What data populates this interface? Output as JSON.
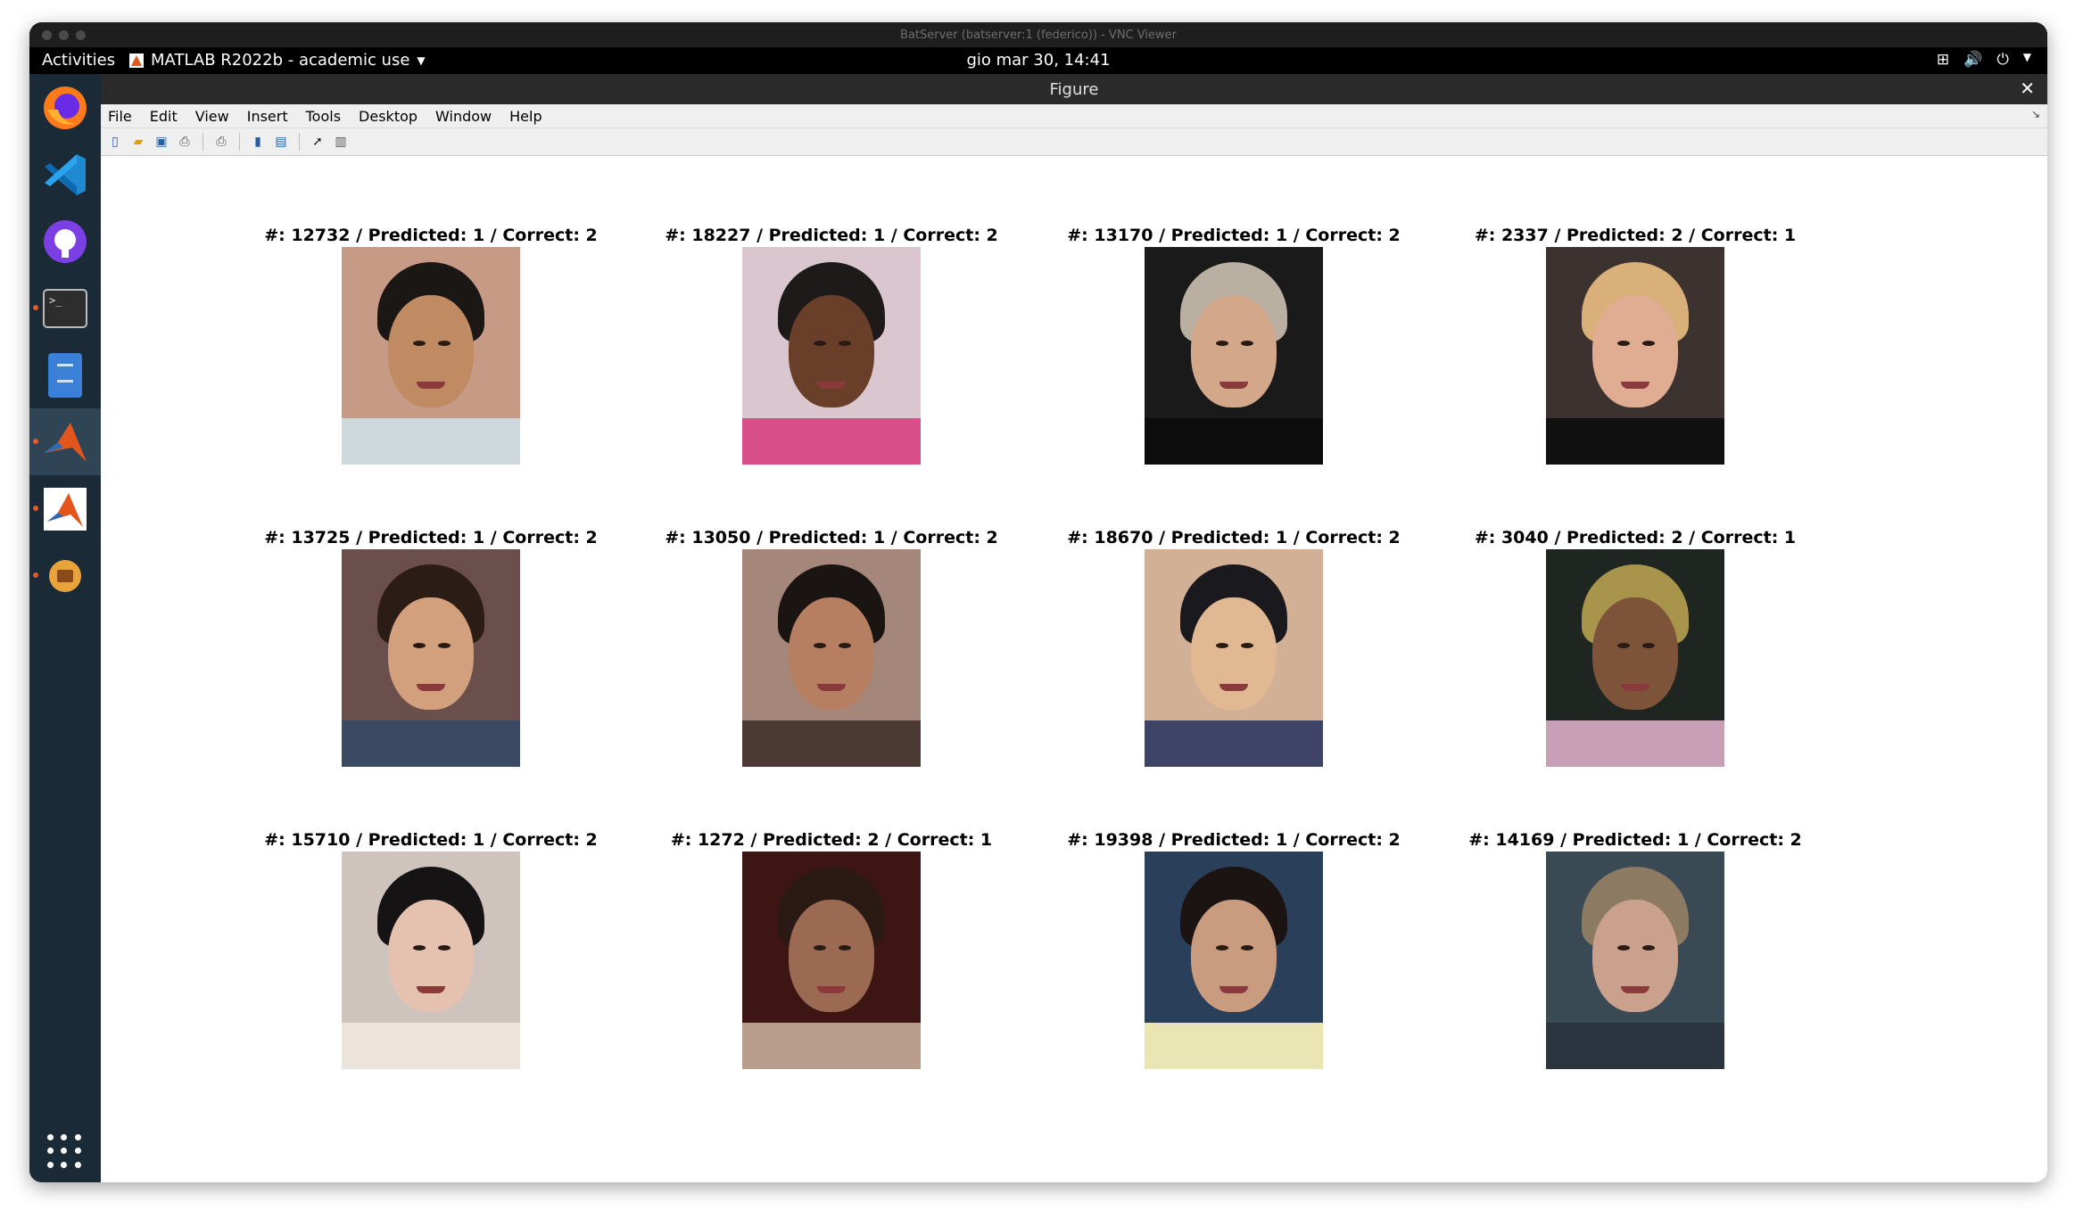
{
  "vnc": {
    "title": "BatServer (batserver:1 (federico)) - VNC Viewer"
  },
  "topbar": {
    "activities": "Activities",
    "app_name": "MATLAB R2022b - academic use",
    "clock": "gio mar 30, 14:41"
  },
  "dock": {
    "items": [
      "firefox-icon",
      "vscode-icon",
      "github-icon",
      "terminal-icon",
      "files-icon",
      "matlab-icon",
      "matlab-alt-icon",
      "software-icon"
    ]
  },
  "figure": {
    "title": "Figure",
    "menu": [
      "File",
      "Edit",
      "View",
      "Insert",
      "Tools",
      "Desktop",
      "Window",
      "Help"
    ],
    "toolbar": [
      "new-file-icon",
      "open-icon",
      "save-icon",
      "print-icon",
      "print-figure-icon",
      "link-icon",
      "insert-legend-icon",
      "pointer-icon",
      "property-editor-icon"
    ]
  },
  "grid": {
    "images": [
      {
        "title": "#: 12732 / Predicted: 1 / Correct: 2",
        "bg": "#c79a86",
        "skin": "#c08a62",
        "hair": "#1b1715",
        "shirt": "#cfd8dc"
      },
      {
        "title": "#: 18227 / Predicted: 1 / Correct: 2",
        "bg": "#d9c6cf",
        "skin": "#6a3f2a",
        "hair": "#1e1a1a",
        "shirt": "#d94f87"
      },
      {
        "title": "#: 13170 / Predicted: 1 / Correct: 2",
        "bg": "#1a1a1a",
        "skin": "#d2a78a",
        "hair": "#b9b0a2",
        "shirt": "#0c0c0c"
      },
      {
        "title": "#: 2337 / Predicted: 2 / Correct: 1",
        "bg": "#3c3330",
        "skin": "#e0ad92",
        "hair": "#d9b07a",
        "shirt": "#111111"
      },
      {
        "title": "#: 13725 / Predicted: 1 / Correct: 2",
        "bg": "#6a4f4c",
        "skin": "#d2a07d",
        "hair": "#2b1d16",
        "shirt": "#3a4a63"
      },
      {
        "title": "#: 13050 / Predicted: 1 / Correct: 2",
        "bg": "#a5867a",
        "skin": "#b67f61",
        "hair": "#1a1513",
        "shirt": "#4b3a33"
      },
      {
        "title": "#: 18670 / Predicted: 1 / Correct: 2",
        "bg": "#d2b095",
        "skin": "#e0b892",
        "hair": "#1a1a1e",
        "shirt": "#3f4466"
      },
      {
        "title": "#: 3040 / Predicted: 2 / Correct: 1",
        "bg": "#1f2520",
        "skin": "#7d533a",
        "hair": "#a8944a",
        "shirt": "#c7a0b6"
      },
      {
        "title": "#: 15710 / Predicted: 1 / Correct: 2",
        "bg": "#cfc4bd",
        "skin": "#e5c1b0",
        "hair": "#151313",
        "shirt": "#ece4dc"
      },
      {
        "title": "#: 1272 / Predicted: 2 / Correct: 1",
        "bg": "#3d1512",
        "skin": "#9c6a52",
        "hair": "#2b1a14",
        "shirt": "#b89c8c"
      },
      {
        "title": "#: 19398 / Predicted: 1 / Correct: 2",
        "bg": "#2a3f5a",
        "skin": "#c99b7f",
        "hair": "#1b1413",
        "shirt": "#eae6b4"
      },
      {
        "title": "#: 14169 / Predicted: 1 / Correct: 2",
        "bg": "#3a4a55",
        "skin": "#c9a18d",
        "hair": "#8c7a62",
        "shirt": "#2c3440"
      }
    ]
  }
}
